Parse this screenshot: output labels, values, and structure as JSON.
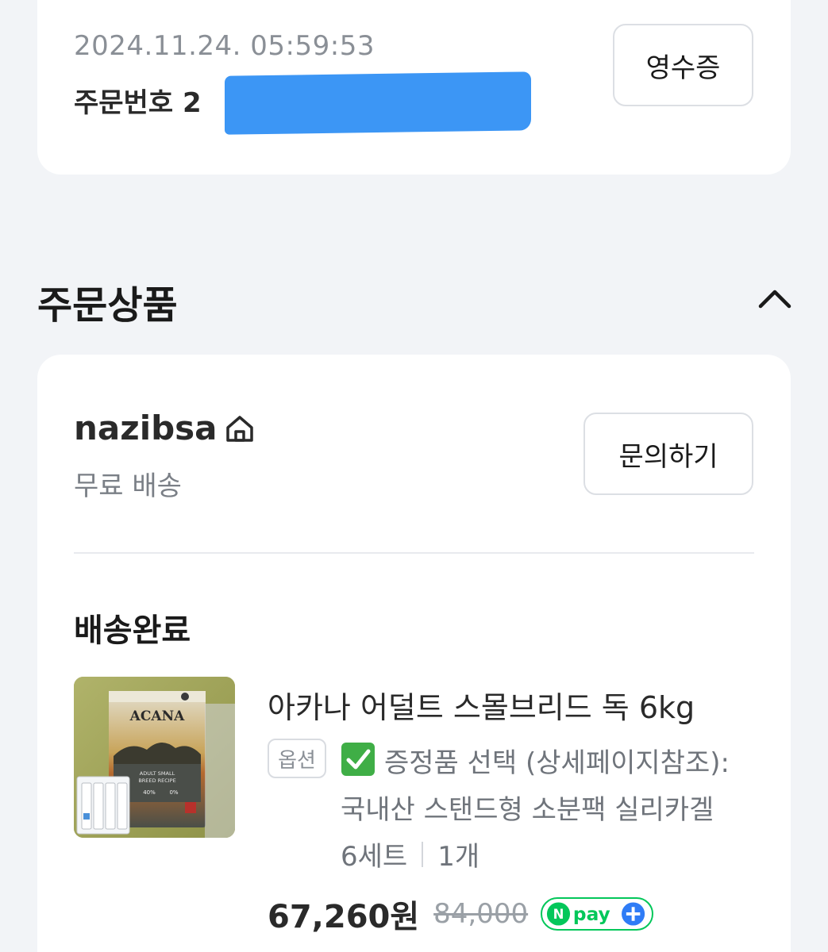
{
  "order": {
    "date": "2024.11.24. 05:59:53",
    "number_label": "주문번호 2",
    "receipt_button": "영수증"
  },
  "section": {
    "title": "주문상품",
    "collapse_icon": "chevron-up-icon"
  },
  "seller": {
    "name": "nazibsa",
    "home_icon": "home-icon",
    "shipping": "무료 배송",
    "inquiry_button": "문의하기"
  },
  "item": {
    "status": "배송완료",
    "name": "아카나 어덜트 스몰브리드 독 6kg",
    "option_badge": "옵션",
    "option_line1": "증정품 선택 (상세페이지참조):",
    "option_line2": "국내산 스탠드형 소분팩 실리카겔",
    "option_line3": "6세트",
    "quantity": "1개",
    "price": "67,260원",
    "original_price": "84,000",
    "pay_badge": "Npay+",
    "thumb_brand": "ACANA",
    "thumb_recipe_line1": "ADULT SMALL",
    "thumb_recipe_line2": "BREED RECIPE",
    "thumb_stat1": "40%",
    "thumb_stat2": "0%"
  },
  "colors": {
    "background": "#f2f4f7",
    "card": "#ffffff",
    "redaction": "#3c96f5",
    "npay_green": "#03c75a",
    "npay_blue": "#2f7cf6"
  }
}
